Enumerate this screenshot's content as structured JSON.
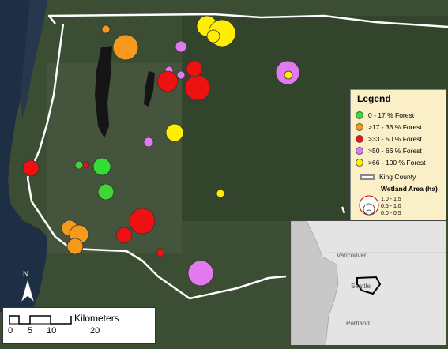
{
  "legend": {
    "title": "Legend",
    "items": [
      {
        "label": "0 - 17 % Forest",
        "color": "#33dd33"
      },
      {
        "label": ">17 - 33 % Forest",
        "color": "#f59a1d"
      },
      {
        "label": ">33 - 50 % Forest",
        "color": "#ee1111"
      },
      {
        "label": ">50 - 66 % Forest",
        "color": "#e07aee"
      },
      {
        "label": ">66 - 100 % Forest",
        "color": "#ffee00"
      }
    ],
    "boundary_label": "King County",
    "wetland_title": "Wetland Area (ha)",
    "wetland_classes": [
      "1.0 - 1.5",
      "0.5 - 1.0",
      "0.0 - 0.5"
    ]
  },
  "inset": {
    "cities": [
      "Vancouver",
      "Seattle",
      "Portland"
    ]
  },
  "scale": {
    "title": "Kilometers",
    "ticks": [
      "0",
      "5",
      "10",
      "20"
    ]
  },
  "north": {
    "label": "N"
  },
  "colors": {
    "boundary": "#ffffff",
    "water": "#1e2e44",
    "land": "#3a4a32"
  }
}
